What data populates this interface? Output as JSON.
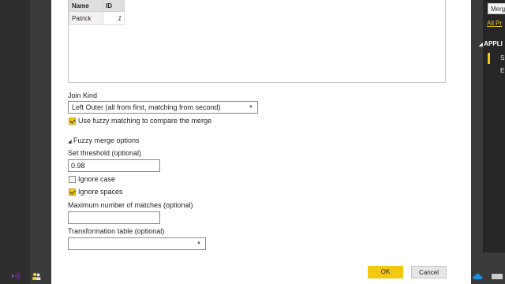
{
  "background": {
    "queries_search_text": "Merg",
    "all_properties_link": "All Pr",
    "applied_steps_header": "APPLI",
    "applied_steps": [
      "S",
      "E"
    ]
  },
  "preview": {
    "columns": [
      "Name",
      "ID"
    ],
    "rows": [
      {
        "name": "Patrick",
        "id": "1"
      }
    ]
  },
  "join_kind": {
    "label": "Join Kind",
    "value": "Left Outer (all from first, matching from second)"
  },
  "fuzzy_matching": {
    "label": "Use fuzzy matching to compare the merge",
    "checked": true
  },
  "fuzzy_options": {
    "header": "Fuzzy merge options",
    "threshold_label": "Set threshold (optional)",
    "threshold_value": "0.98",
    "ignore_case_label": "Ignore case",
    "ignore_case_checked": false,
    "ignore_spaces_label": "Ignore spaces",
    "ignore_spaces_checked": true,
    "max_matches_label": "Maximum number of matches (optional)",
    "max_matches_value": "",
    "transformation_label": "Transformation table (optional)",
    "transformation_value": ""
  },
  "buttons": {
    "ok": "OK",
    "cancel": "Cancel"
  },
  "colors": {
    "accent": "#f2c811",
    "dialog_bg": "#ffffff",
    "app_bg": "#3c3c3c"
  },
  "icons": [
    "visual-studio-icon",
    "people-icon",
    "onedrive-cloud-icon"
  ]
}
